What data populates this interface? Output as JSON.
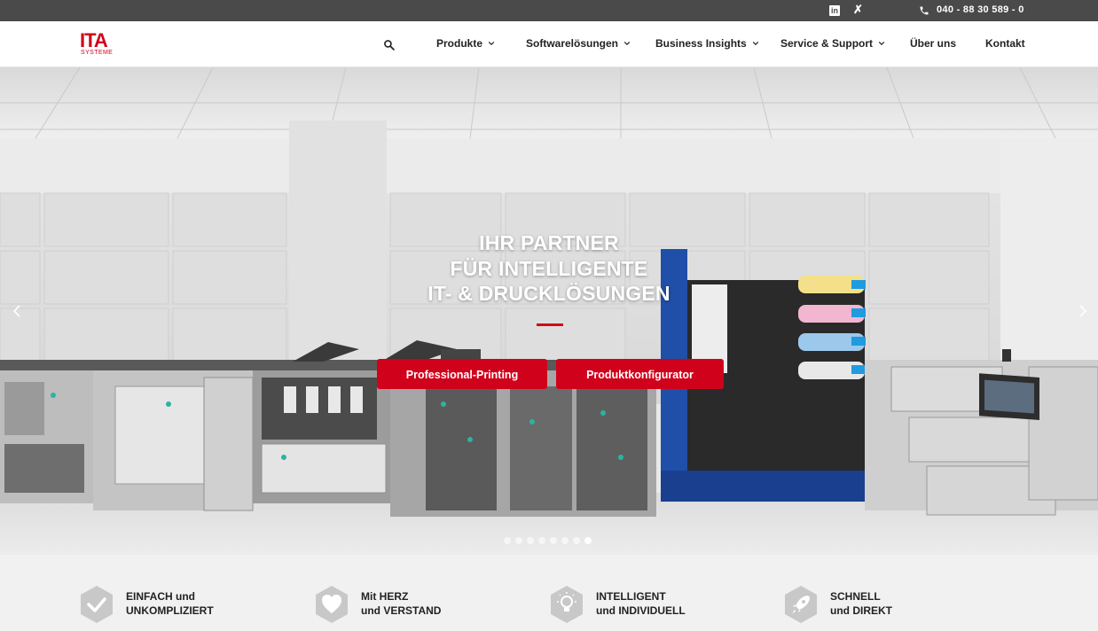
{
  "topbar": {
    "linkedin_icon": "linkedin-icon",
    "xing_icon": "xing-icon",
    "phone_icon": "phone-icon",
    "phone": "040 - 88 30 589 - 0"
  },
  "header": {
    "logo": {
      "main": "ITA",
      "sub": "SYSTEME"
    },
    "search_icon": "search-icon",
    "nav": [
      {
        "label": "Produkte",
        "has_dropdown": true
      },
      {
        "label": "Softwarelösungen",
        "has_dropdown": true
      },
      {
        "label": "Business Insights",
        "has_dropdown": true
      },
      {
        "label": "Service & Support",
        "has_dropdown": true
      },
      {
        "label": "Über uns",
        "has_dropdown": false
      },
      {
        "label": "Kontakt",
        "has_dropdown": false
      }
    ]
  },
  "hero": {
    "title_lines": [
      "IHR PARTNER",
      "FÜR INTELLIGENTE",
      "IT- & DRUCKLÖSUNGEN"
    ],
    "buttons": [
      "Professional-Printing",
      "Produktkonfigurator"
    ],
    "slides_total": 8,
    "active_slide": 8
  },
  "features": [
    {
      "icon": "checkmark-icon",
      "line1": "EINFACH und",
      "line2": "UNKOMPLIZIERT"
    },
    {
      "icon": "heart-icon",
      "line1": "Mit HERZ",
      "line2": "und VERSTAND"
    },
    {
      "icon": "lightbulb-icon",
      "line1": "INTELLIGENT",
      "line2": "und INDIVIDUELL"
    },
    {
      "icon": "rocket-icon",
      "line1": "SCHNELL",
      "line2": "und DIREKT"
    }
  ],
  "colors": {
    "brand_red": "#d0021b",
    "topbar_bg": "#4a4a4a",
    "features_bg": "#f1f1f1"
  }
}
